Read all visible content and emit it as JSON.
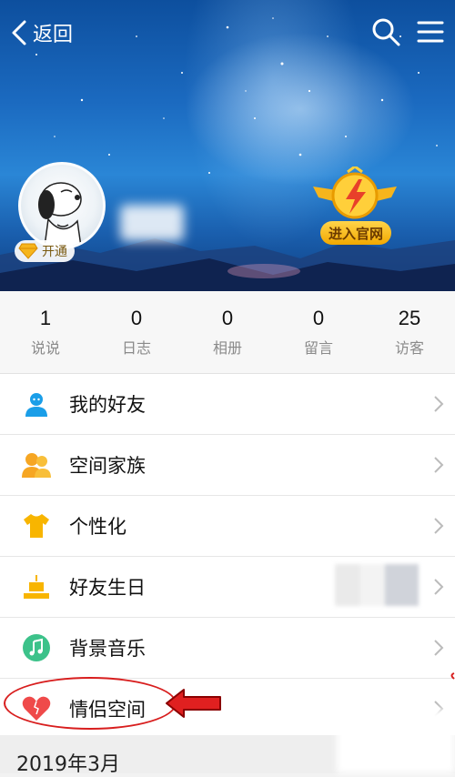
{
  "header": {
    "back_label": "返回",
    "vip_label": "开通",
    "official_label": "进入官网"
  },
  "stats": [
    {
      "value": "1",
      "label": "说说"
    },
    {
      "value": "0",
      "label": "日志"
    },
    {
      "value": "0",
      "label": "相册"
    },
    {
      "value": "0",
      "label": "留言"
    },
    {
      "value": "25",
      "label": "访客"
    }
  ],
  "menu": [
    {
      "label": "我的好友",
      "icon": "friend-icon",
      "color": "#1a9ee8"
    },
    {
      "label": "空间家族",
      "icon": "family-icon",
      "color": "#f6a623"
    },
    {
      "label": "个性化",
      "icon": "tshirt-icon",
      "color": "#f8b500"
    },
    {
      "label": "好友生日",
      "icon": "cake-icon",
      "color": "#f8b500"
    },
    {
      "label": "背景音乐",
      "icon": "music-icon",
      "color": "#3cc28a"
    },
    {
      "label": "情侣空间",
      "icon": "heart-icon",
      "color": "#ef4a4a"
    }
  ],
  "section": {
    "date": "2019年3月"
  }
}
